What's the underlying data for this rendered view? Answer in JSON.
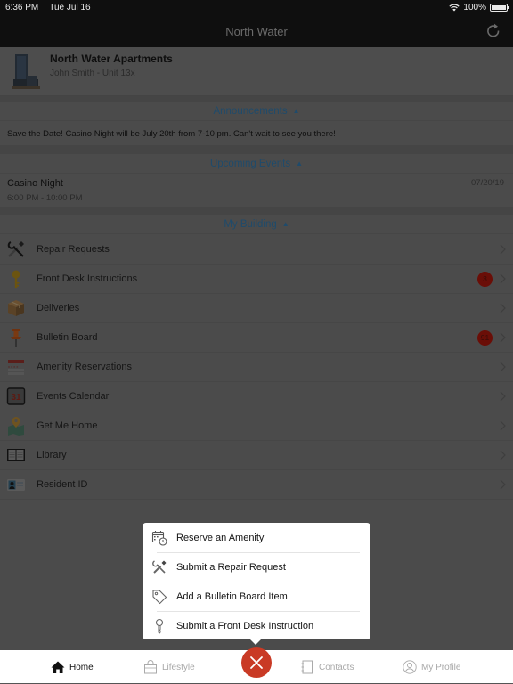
{
  "status_bar": {
    "time": "6:36 PM",
    "date": "Tue Jul 16",
    "battery_percent": "100%",
    "battery_level": 1.0,
    "wifi_icon": "wifi-icon",
    "battery_icon": "battery-icon"
  },
  "navbar": {
    "title": "North Water",
    "refresh_icon": "refresh-icon"
  },
  "property": {
    "name": "North Water Apartments",
    "resident": "John Smith - Unit 13x",
    "thumbnail_icon": "building-icon"
  },
  "sections": {
    "announcements": {
      "title": "Announcements",
      "caret": "▲",
      "items": [
        "Save the Date! Casino Night will be July 20th from 7-10 pm. Can't wait to see you there!"
      ]
    },
    "events": {
      "title": "Upcoming Events",
      "caret": "▲",
      "items": [
        {
          "name": "Casino Night",
          "time": "6:00 PM - 10:00 PM",
          "date": "07/20/19"
        }
      ]
    },
    "building": {
      "title": "My Building",
      "caret": "▲",
      "items": [
        {
          "label": "Repair Requests",
          "icon": "tools-icon",
          "badge": null
        },
        {
          "label": "Front Desk Instructions",
          "icon": "key-icon",
          "badge": "3"
        },
        {
          "label": "Deliveries",
          "icon": "package-icon",
          "badge": null
        },
        {
          "label": "Bulletin Board",
          "icon": "pushpin-icon",
          "badge": "91"
        },
        {
          "label": "Amenity Reservations",
          "icon": "reservation-calendar-icon",
          "badge": null
        },
        {
          "label": "Events Calendar",
          "icon": "calendar-31-icon",
          "badge": null
        },
        {
          "label": "Get Me Home",
          "icon": "map-pin-icon",
          "badge": null
        },
        {
          "label": "Library",
          "icon": "book-icon",
          "badge": null
        },
        {
          "label": "Resident ID",
          "icon": "id-card-icon",
          "badge": null
        }
      ]
    }
  },
  "popup_menu": {
    "items": [
      {
        "label": "Reserve an Amenity",
        "icon": "calendar-clock-icon"
      },
      {
        "label": "Submit a Repair Request",
        "icon": "tools-icon"
      },
      {
        "label": "Add a Bulletin Board Item",
        "icon": "tag-icon"
      },
      {
        "label": "Submit a Front Desk Instruction",
        "icon": "key-icon"
      }
    ]
  },
  "tabbar": {
    "tabs": [
      {
        "label": "Home",
        "icon": "home-icon",
        "active": true
      },
      {
        "label": "Lifestyle",
        "icon": "shopping-bag-icon",
        "active": false
      },
      {
        "label": "Contacts",
        "icon": "address-book-icon",
        "active": false
      },
      {
        "label": "My Profile",
        "icon": "user-circle-icon",
        "active": false
      }
    ],
    "fab_icon": "close-icon"
  },
  "colors": {
    "accent_red": "#c93a25",
    "badge_red": "#6a0e07",
    "section_blue": "#1f4b6b"
  }
}
